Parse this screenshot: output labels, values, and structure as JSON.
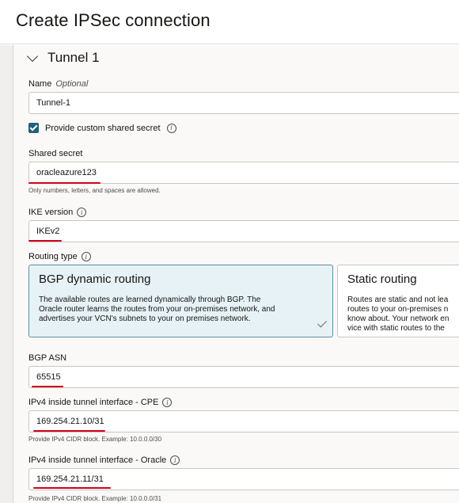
{
  "page": {
    "title": "Create IPSec connection"
  },
  "tunnel": {
    "title": "Tunnel 1"
  },
  "name_field": {
    "label": "Name",
    "optional": "Optional",
    "value": "Tunnel-1"
  },
  "custom_secret": {
    "label": "Provide custom shared secret",
    "checked": true
  },
  "shared_secret": {
    "label": "Shared secret",
    "value": "oracleazure123",
    "hint": "Only numbers, letters, and spaces are allowed."
  },
  "ike_version": {
    "label": "IKE version",
    "value": "IKEv2"
  },
  "routing": {
    "label": "Routing type",
    "options": [
      {
        "title": "BGP dynamic routing",
        "lines": [
          "The available routes are learned dynamically through BGP. The",
          "Oracle router learns the routes from your on-premises network, and",
          "advertises your VCN's subnets to your on premises network."
        ],
        "selected": true
      },
      {
        "title": "Static routing",
        "lines": [
          "Routes are static and not lea",
          "routes to your on-premises n",
          "know about. Your network en",
          "vice with static routes to the"
        ],
        "selected": false
      }
    ]
  },
  "bgp_asn": {
    "label": "BGP ASN",
    "value": "65515"
  },
  "ipv4_cpe": {
    "label": "IPv4 inside tunnel interface - CPE",
    "value": "169.254.21.10/31",
    "hint": "Provide IPv4 CIDR block. Example: 10.0.0.0/30"
  },
  "ipv4_oracle": {
    "label": "IPv4 inside tunnel interface - Oracle",
    "value": "169.254.21.11/31",
    "hint": "Provide IPv4 CIDR block. Example: 10.0.0.0/31"
  },
  "colors": {
    "highlight_underline": "#d0021b",
    "checkbox": "#20607d",
    "selected_tile_bg": "#e6f2f6",
    "selected_tile_border": "#5d8fa4"
  }
}
